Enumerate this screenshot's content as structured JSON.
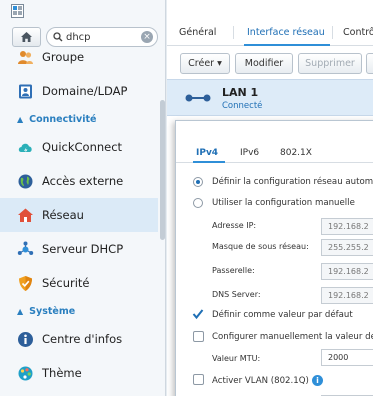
{
  "search": {
    "value": "dhcp"
  },
  "sidebar": {
    "items_top": [
      {
        "label": "Groupe",
        "icon": "group-icon"
      },
      {
        "label": "Domaine/LDAP",
        "icon": "domain-ldap-icon"
      }
    ],
    "section_connectivity": "Connectivité",
    "items_conn": [
      {
        "label": "QuickConnect",
        "icon": "quickconnect-icon"
      },
      {
        "label": "Accès externe",
        "icon": "globe-icon"
      },
      {
        "label": "Réseau",
        "icon": "home-network-icon",
        "active": true
      },
      {
        "label": "Serveur DHCP",
        "icon": "dhcp-server-icon"
      },
      {
        "label": "Sécurité",
        "icon": "shield-icon"
      }
    ],
    "section_system": "Système",
    "items_sys": [
      {
        "label": "Centre d'infos",
        "icon": "info-icon"
      },
      {
        "label": "Thème",
        "icon": "theme-icon"
      }
    ]
  },
  "tabs": {
    "general": "Général",
    "interface": "Interface réseau",
    "control": "Contrô"
  },
  "toolbar": {
    "create": "Créer ▾",
    "modify": "Modifier",
    "delete": "Supprimer"
  },
  "lan": {
    "name": "LAN 1",
    "status": "Connecté"
  },
  "dialog": {
    "tabs": {
      "ipv4": "IPv4",
      "ipv6": "IPv6",
      "dot1x": "802.1X"
    },
    "opt_auto": "Définir la configuration réseau automa",
    "opt_manual": "Utiliser la configuration manuelle",
    "ip_label": "Adresse IP:",
    "ip_value": "192.168.2",
    "mask_label": "Masque de sous réseau:",
    "mask_value": "255.255.2",
    "gw_label": "Passerelle:",
    "gw_value": "192.168.2",
    "dns_label": "DNS Server:",
    "dns_value": "192.168.2",
    "default_label": "Définir comme valeur par défaut",
    "manual_label": "Configurer manuellement la valeur de",
    "mtu_label": "Valeur MTU:",
    "mtu_value": "2000",
    "vlan_label": "Activer VLAN (802.1Q)"
  },
  "colors": {
    "accent": "#2f8fd8",
    "active_bg": "#dbeaf7",
    "section": "#2a7fbf"
  }
}
